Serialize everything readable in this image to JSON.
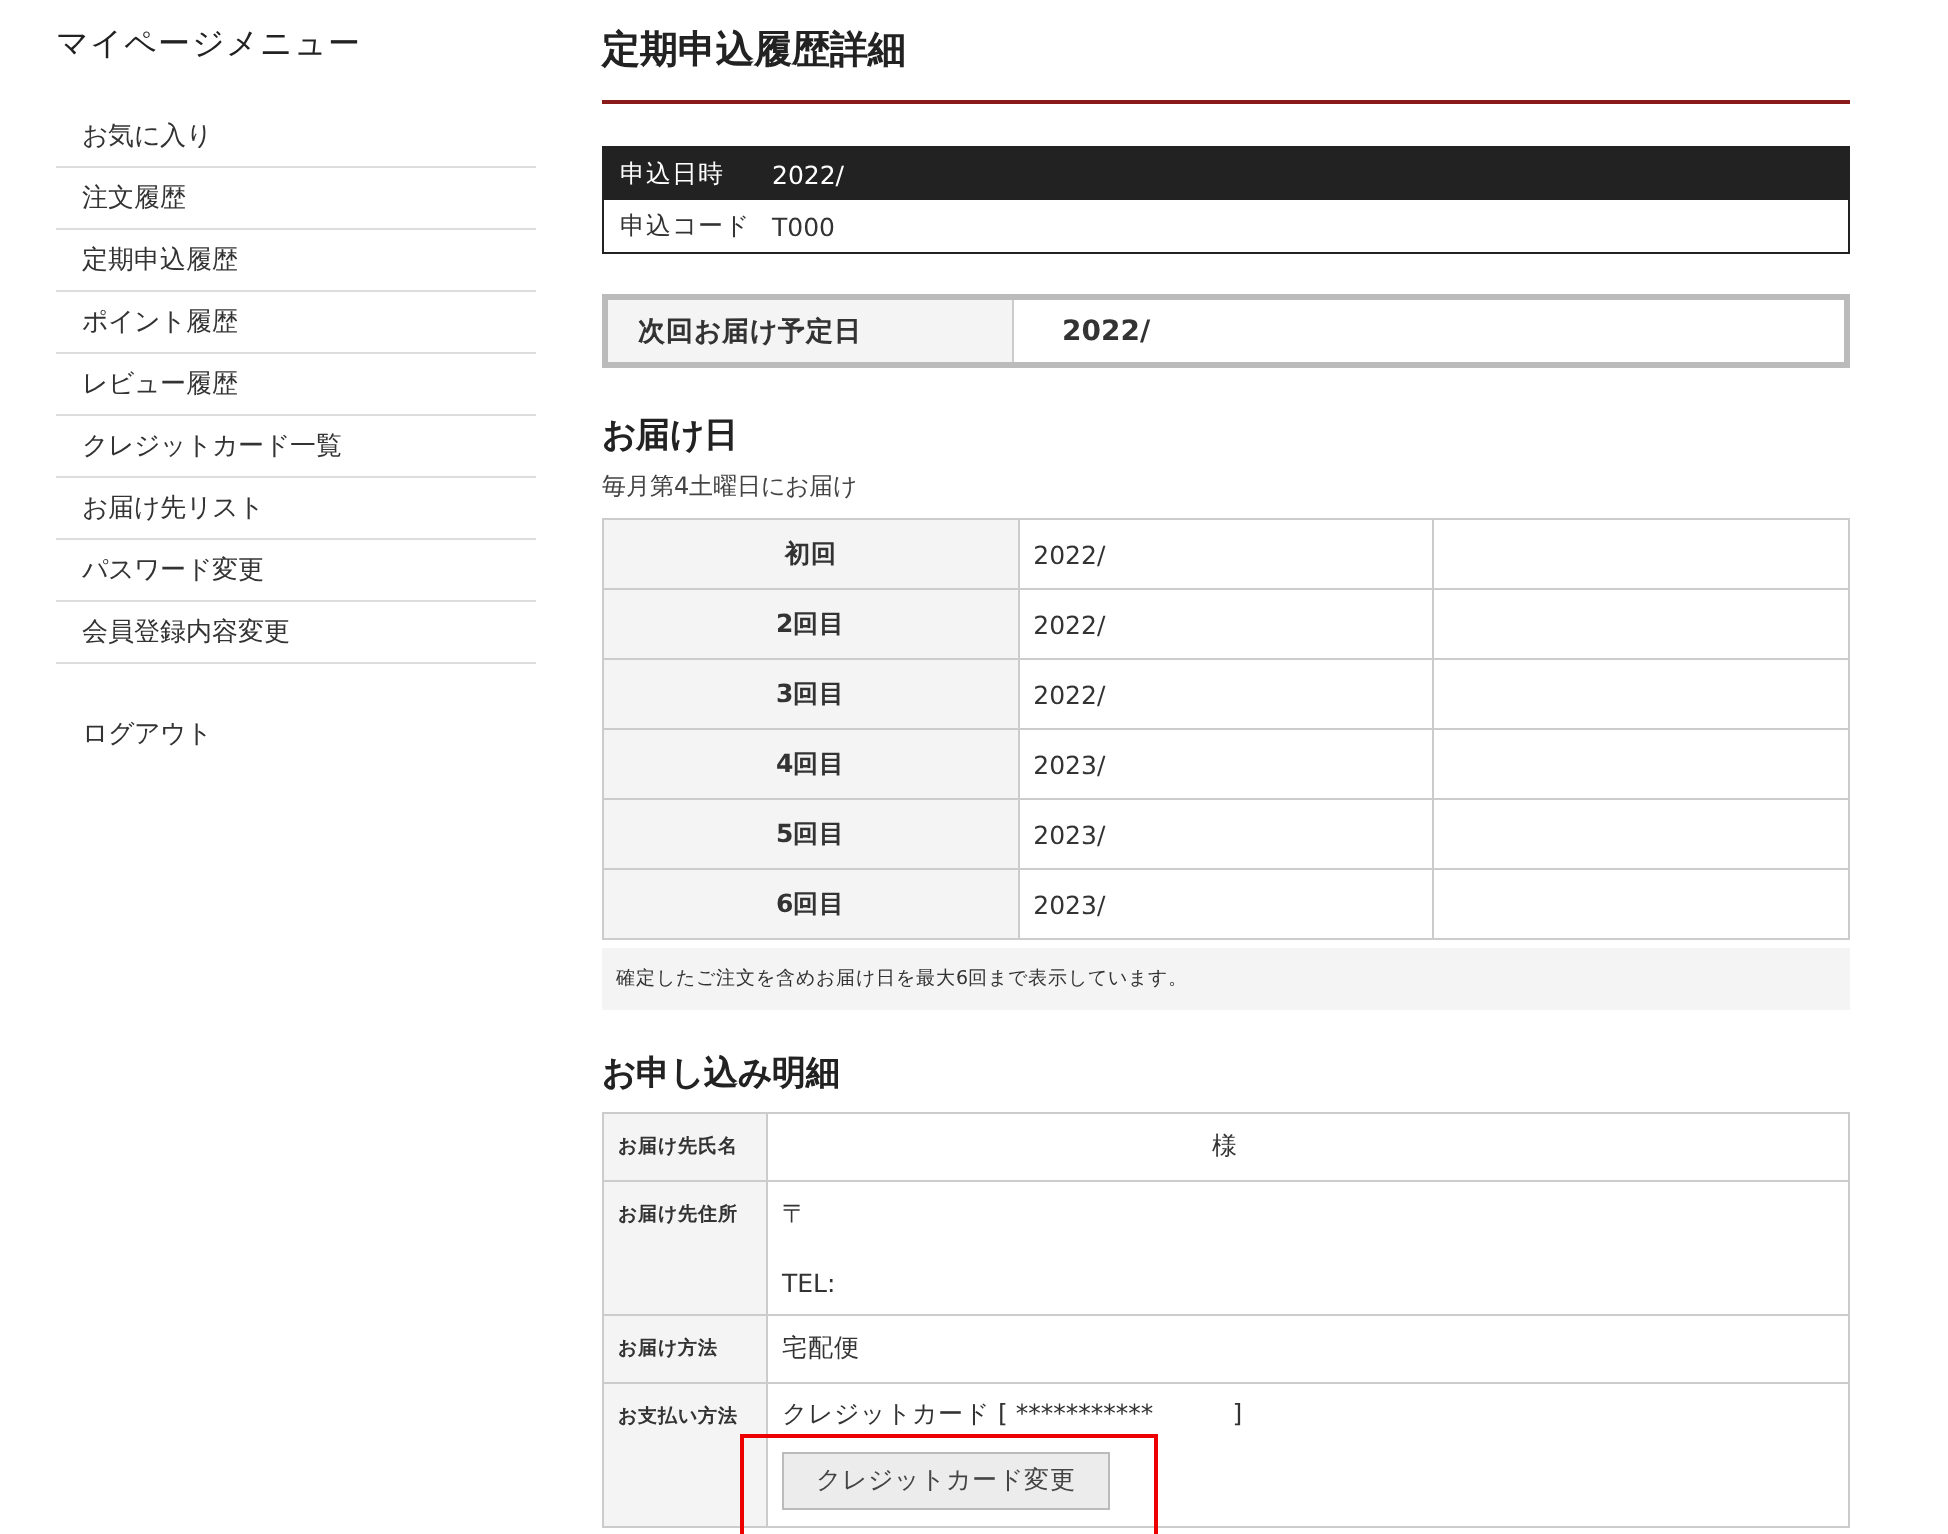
{
  "sidebar": {
    "title": "マイページメニュー",
    "items": [
      "お気に入り",
      "注文履歴",
      "定期申込履歴",
      "ポイント履歴",
      "レビュー履歴",
      "クレジットカード一覧",
      "お届け先リスト",
      "パスワード変更",
      "会員登録内容変更"
    ],
    "logout": "ログアウト"
  },
  "page_title": "定期申込履歴詳細",
  "summary": [
    {
      "label": "申込日時",
      "value": "2022/",
      "kind": "header"
    },
    {
      "label": "申込コード",
      "value": "T000",
      "kind": "plain"
    }
  ],
  "next_delivery": {
    "label": "次回お届け予定日",
    "value": "2022/"
  },
  "delivery": {
    "heading": "お届け日",
    "schedule": "毎月第4土曜日にお届け",
    "rows": [
      {
        "label": "初回",
        "date": "2022/"
      },
      {
        "label": "2回目",
        "date": "2022/"
      },
      {
        "label": "3回目",
        "date": "2022/"
      },
      {
        "label": "4回目",
        "date": "2023/"
      },
      {
        "label": "5回目",
        "date": "2023/"
      },
      {
        "label": "6回目",
        "date": "2023/"
      }
    ],
    "note": "確定したご注文を含めお届け日を最大6回まで表示しています。"
  },
  "details": {
    "heading": "お申し込み明細",
    "rows": [
      {
        "label": "お届け先氏名",
        "kind": "name",
        "value": "様"
      },
      {
        "label": "お届け先住所",
        "kind": "address",
        "postal": "〒",
        "tel": "TEL:"
      },
      {
        "label": "お届け方法",
        "kind": "text",
        "value": "宅配便"
      },
      {
        "label": "お支払い方法",
        "kind": "payment",
        "value": "クレジットカード [ ***********          ]",
        "button": "クレジットカード変更",
        "highlighted": true
      }
    ]
  }
}
